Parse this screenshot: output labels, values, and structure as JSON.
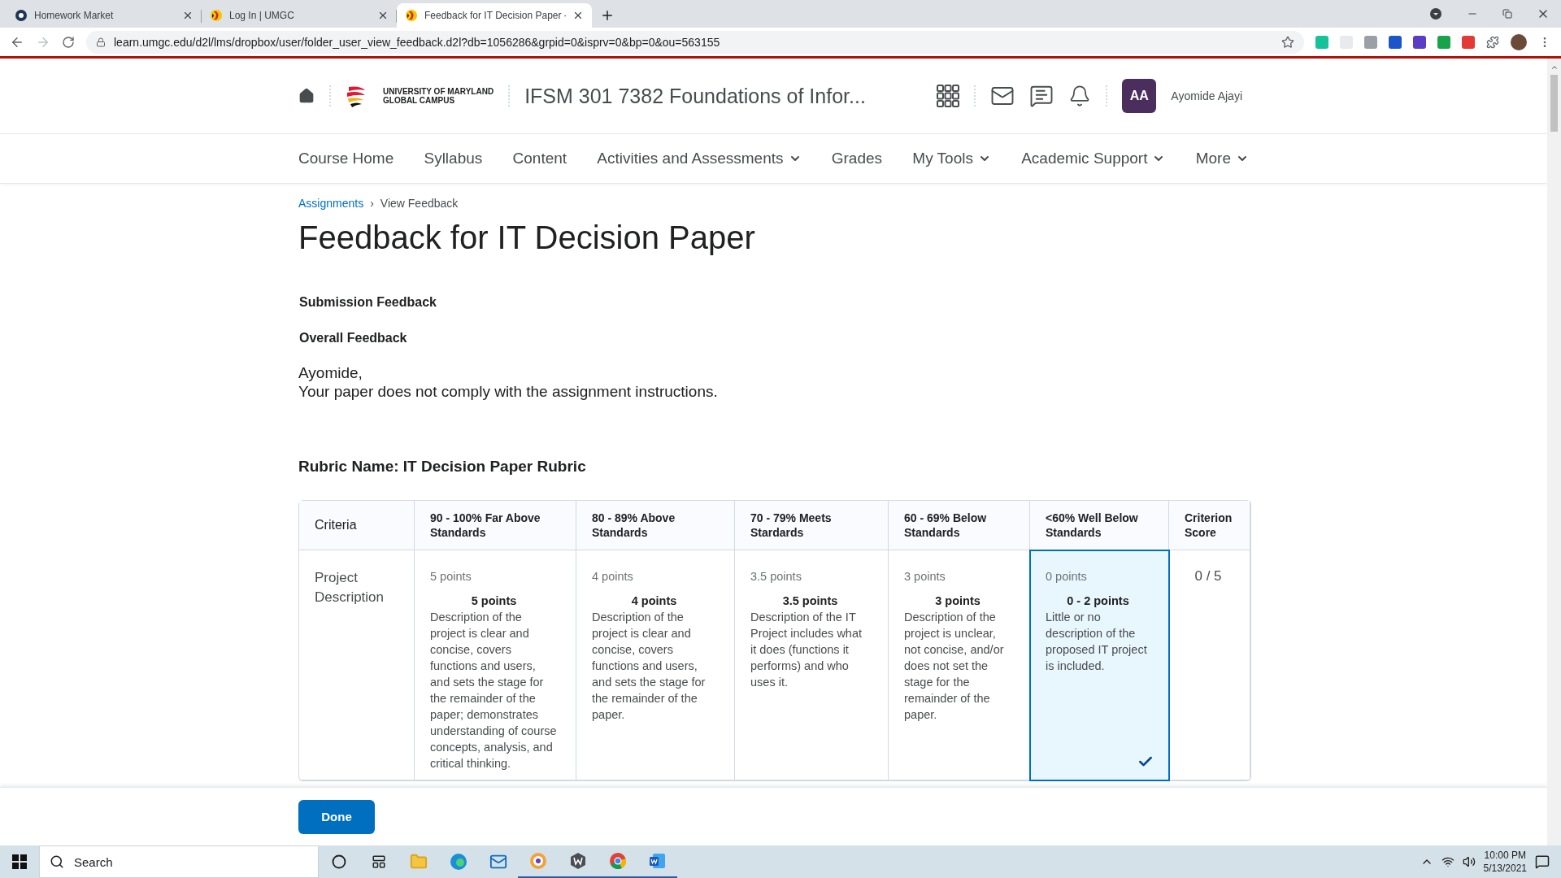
{
  "browser": {
    "tabs": [
      {
        "title": "Homework Market",
        "selected": false
      },
      {
        "title": "Log In | UMGC",
        "selected": false
      },
      {
        "title": "Feedback for IT Decision Paper -",
        "selected": true
      }
    ],
    "url": "learn.umgc.edu/d2l/lms/dropbox/user/folder_user_view_feedback.d2l?db=1056286&grpid=0&isprv=0&bp=0&ou=563155"
  },
  "header": {
    "logo": [
      "UNIVERSITY OF MARYLAND",
      "GLOBAL CAMPUS"
    ],
    "course_title": "IFSM 301 7382 Foundations of Infor...",
    "user": {
      "initials": "AA",
      "name": "Ayomide Ajayi"
    }
  },
  "nav": [
    {
      "label": "Course Home",
      "has_menu": false
    },
    {
      "label": "Syllabus",
      "has_menu": false
    },
    {
      "label": "Content",
      "has_menu": false
    },
    {
      "label": "Activities and Assessments",
      "has_menu": true
    },
    {
      "label": "Grades",
      "has_menu": false
    },
    {
      "label": "My Tools",
      "has_menu": true
    },
    {
      "label": "Academic Support",
      "has_menu": true
    },
    {
      "label": "More",
      "has_menu": true
    }
  ],
  "breadcrumb": {
    "link": "Assignments",
    "separator": "›",
    "current": "View Feedback"
  },
  "page_title": "Feedback for IT Decision Paper",
  "submission_heading": "Submission Feedback",
  "overall_heading": "Overall Feedback",
  "feedback_lines": [
    "Ayomide,",
    "Your paper does not comply with the assignment instructions."
  ],
  "rubric": {
    "name": "Rubric Name: IT Decision Paper Rubric",
    "columns": [
      "Criteria",
      "90 - 100% Far Above Standards",
      "80 - 89% Above Standards",
      "70 - 79% Meets Stardards",
      "60 - 69% Below Standards",
      "<60% Well Below Standards",
      "Criterion Score"
    ],
    "rows": [
      {
        "criterion": "Project Description",
        "score": "0 / 5",
        "levels": [
          {
            "points": "5 points",
            "range": "5 points",
            "description": "Description of the project is clear and concise, covers functions and users, and sets the stage for the remainder of the paper; demonstrates understanding of course concepts, analysis, and critical thinking.",
            "selected": false
          },
          {
            "points": "4 points",
            "range": "4 points",
            "description": "Description of the project is clear and concise, covers functions and users, and sets the stage for the remainder of the paper.",
            "selected": false
          },
          {
            "points": "3.5 points",
            "range": "3.5 points",
            "description": "Description of the IT Project includes what it does (functions it performs) and who uses it.",
            "selected": false
          },
          {
            "points": "3 points",
            "range": "3 points",
            "description": "Description of the project is unclear, not concise, and/or does not set the stage for the remainder of the paper.",
            "selected": false
          },
          {
            "points": "0 points",
            "range": "0 - 2 points",
            "description": "Little or no description of the proposed IT project is included.",
            "selected": true
          }
        ]
      }
    ]
  },
  "done_button": "Done",
  "taskbar": {
    "search_placeholder": "Search",
    "time": "10:00 PM",
    "date": "5/13/2021"
  }
}
